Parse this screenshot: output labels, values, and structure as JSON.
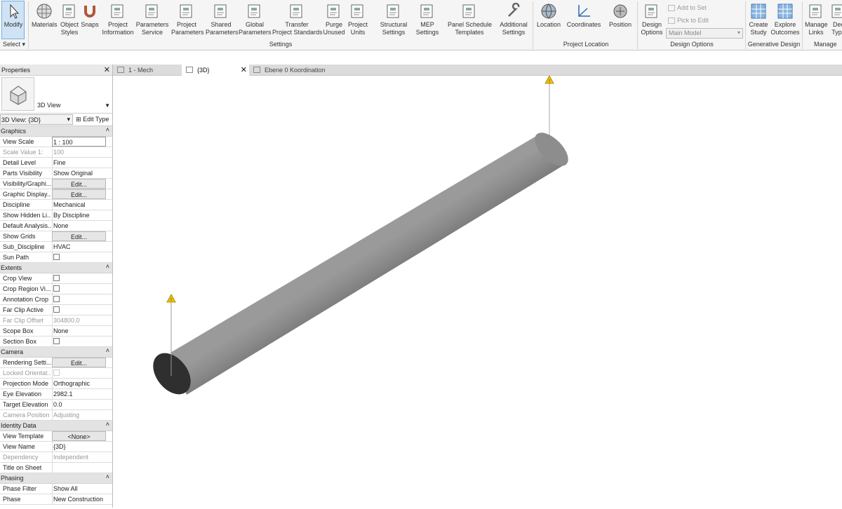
{
  "ribbon": {
    "buttons": [
      {
        "label1": "Modify",
        "label2": "",
        "icon": "cursor-icon"
      },
      {
        "label1": "Materials",
        "label2": "",
        "icon": "materials-sphere-icon"
      },
      {
        "label1": "Object",
        "label2": "Styles",
        "icon": "object-styles-icon"
      },
      {
        "label1": "Snaps",
        "label2": "",
        "icon": "magnet-icon"
      },
      {
        "label1": "Project",
        "label2": "Information",
        "icon": "project-info-icon"
      },
      {
        "label1": "Parameters",
        "label2": "Service",
        "icon": "parameters-service-icon"
      },
      {
        "label1": "Project",
        "label2": "Parameters",
        "icon": "project-parameters-icon"
      },
      {
        "label1": "Shared",
        "label2": "Parameters",
        "icon": "shared-parameters-icon"
      },
      {
        "label1": "Global",
        "label2": "Parameters",
        "icon": "global-parameters-icon"
      },
      {
        "label1": "Transfer",
        "label2": "Project Standards",
        "icon": "transfer-standards-icon"
      },
      {
        "label1": "Purge",
        "label2": "Unused",
        "icon": "purge-icon"
      },
      {
        "label1": "Project",
        "label2": "Units",
        "icon": "units-icon"
      },
      {
        "label1": "Structural",
        "label2": "Settings",
        "icon": "structural-settings-icon"
      },
      {
        "label1": "MEP",
        "label2": "Settings",
        "icon": "mep-settings-icon"
      },
      {
        "label1": "Panel Schedule",
        "label2": "Templates",
        "icon": "panel-schedule-icon"
      },
      {
        "label1": "Additional",
        "label2": "Settings",
        "icon": "wrench-icon"
      },
      {
        "label1": "Location",
        "label2": "",
        "icon": "globe-icon"
      },
      {
        "label1": "Coordinates",
        "label2": "",
        "icon": "coordinates-icon"
      },
      {
        "label1": "Position",
        "label2": "",
        "icon": "position-icon"
      },
      {
        "label1": "Design",
        "label2": "Options",
        "icon": "design-options-icon"
      },
      {
        "label1": "Create",
        "label2": "Study",
        "icon": "create-study-icon"
      },
      {
        "label1": "Explore",
        "label2": "Outcomes",
        "icon": "explore-outcomes-icon"
      },
      {
        "label1": "Manage",
        "label2": "Links",
        "icon": "manage-links-icon"
      },
      {
        "label1": "Dec",
        "label2": "Type",
        "icon": "decal-types-icon"
      }
    ],
    "add_to_set": "Add to Set",
    "pick_to_edit": "Pick to Edit",
    "main_model": "Main Model",
    "panels": {
      "select": "Select",
      "settings": "Settings",
      "project_location": "Project Location",
      "design_options": "Design Options",
      "generative_design": "Generative Design",
      "manage": "Manage"
    }
  },
  "properties": {
    "title": "Properties",
    "type_name": "3D View",
    "instance": "3D View: {3D}",
    "edit_type": "Edit Type",
    "sections": [
      {
        "name": "Graphics",
        "rows": [
          {
            "k": "View Scale",
            "v": "1 : 100",
            "kind": "box"
          },
          {
            "k": "Scale Value    1:",
            "v": "100",
            "kind": "dim"
          },
          {
            "k": "Detail Level",
            "v": "Fine"
          },
          {
            "k": "Parts Visibility",
            "v": "Show Original"
          },
          {
            "k": "Visibility/Graphi...",
            "v": "Edit...",
            "kind": "btn"
          },
          {
            "k": "Graphic Display...",
            "v": "Edit...",
            "kind": "btn"
          },
          {
            "k": "Discipline",
            "v": "Mechanical"
          },
          {
            "k": "Show Hidden Li...",
            "v": "By Discipline"
          },
          {
            "k": "Default Analysis...",
            "v": "None"
          },
          {
            "k": "Show Grids",
            "v": "Edit...",
            "kind": "btn"
          },
          {
            "k": "Sub_Discipline",
            "v": "HVAC"
          },
          {
            "k": "Sun Path",
            "v": "",
            "kind": "cb"
          }
        ]
      },
      {
        "name": "Extents",
        "rows": [
          {
            "k": "Crop View",
            "v": "",
            "kind": "cb"
          },
          {
            "k": "Crop Region Vi...",
            "v": "",
            "kind": "cb"
          },
          {
            "k": "Annotation Crop",
            "v": "",
            "kind": "cb"
          },
          {
            "k": "Far Clip Active",
            "v": "",
            "kind": "cb"
          },
          {
            "k": "Far Clip Offset",
            "v": "304800.0",
            "kind": "dim"
          },
          {
            "k": "Scope Box",
            "v": "None"
          },
          {
            "k": "Section Box",
            "v": "",
            "kind": "cb"
          }
        ]
      },
      {
        "name": "Camera",
        "rows": [
          {
            "k": "Rendering Setti...",
            "v": "Edit...",
            "kind": "btn"
          },
          {
            "k": "Locked Orientat...",
            "v": "",
            "kind": "dimcb"
          },
          {
            "k": "Projection Mode",
            "v": "Orthographic"
          },
          {
            "k": "Eye Elevation",
            "v": "2982.1"
          },
          {
            "k": "Target Elevation",
            "v": "0.0"
          },
          {
            "k": "Camera Position",
            "v": "Adjusting",
            "kind": "dim"
          }
        ]
      },
      {
        "name": "Identity Data",
        "rows": [
          {
            "k": "View Template",
            "v": "<None>",
            "kind": "btn"
          },
          {
            "k": "View Name",
            "v": "{3D}"
          },
          {
            "k": "Dependency",
            "v": "Independent",
            "kind": "dim"
          },
          {
            "k": "Title on Sheet",
            "v": ""
          }
        ]
      },
      {
        "name": "Phasing",
        "rows": [
          {
            "k": "Phase Filter",
            "v": "Show All"
          },
          {
            "k": "Phase",
            "v": "New Construction"
          }
        ]
      }
    ]
  },
  "tabs": [
    {
      "label": "1 - Mech",
      "active": false
    },
    {
      "label": "{3D}",
      "active": true
    },
    {
      "label": "Ebene 0 Koordination",
      "active": false
    }
  ],
  "viewport": {
    "model": "pipe",
    "pipe_color": "#8a8a8a",
    "end_color": "#2f2f2f",
    "warning_color": "#f2c200"
  }
}
